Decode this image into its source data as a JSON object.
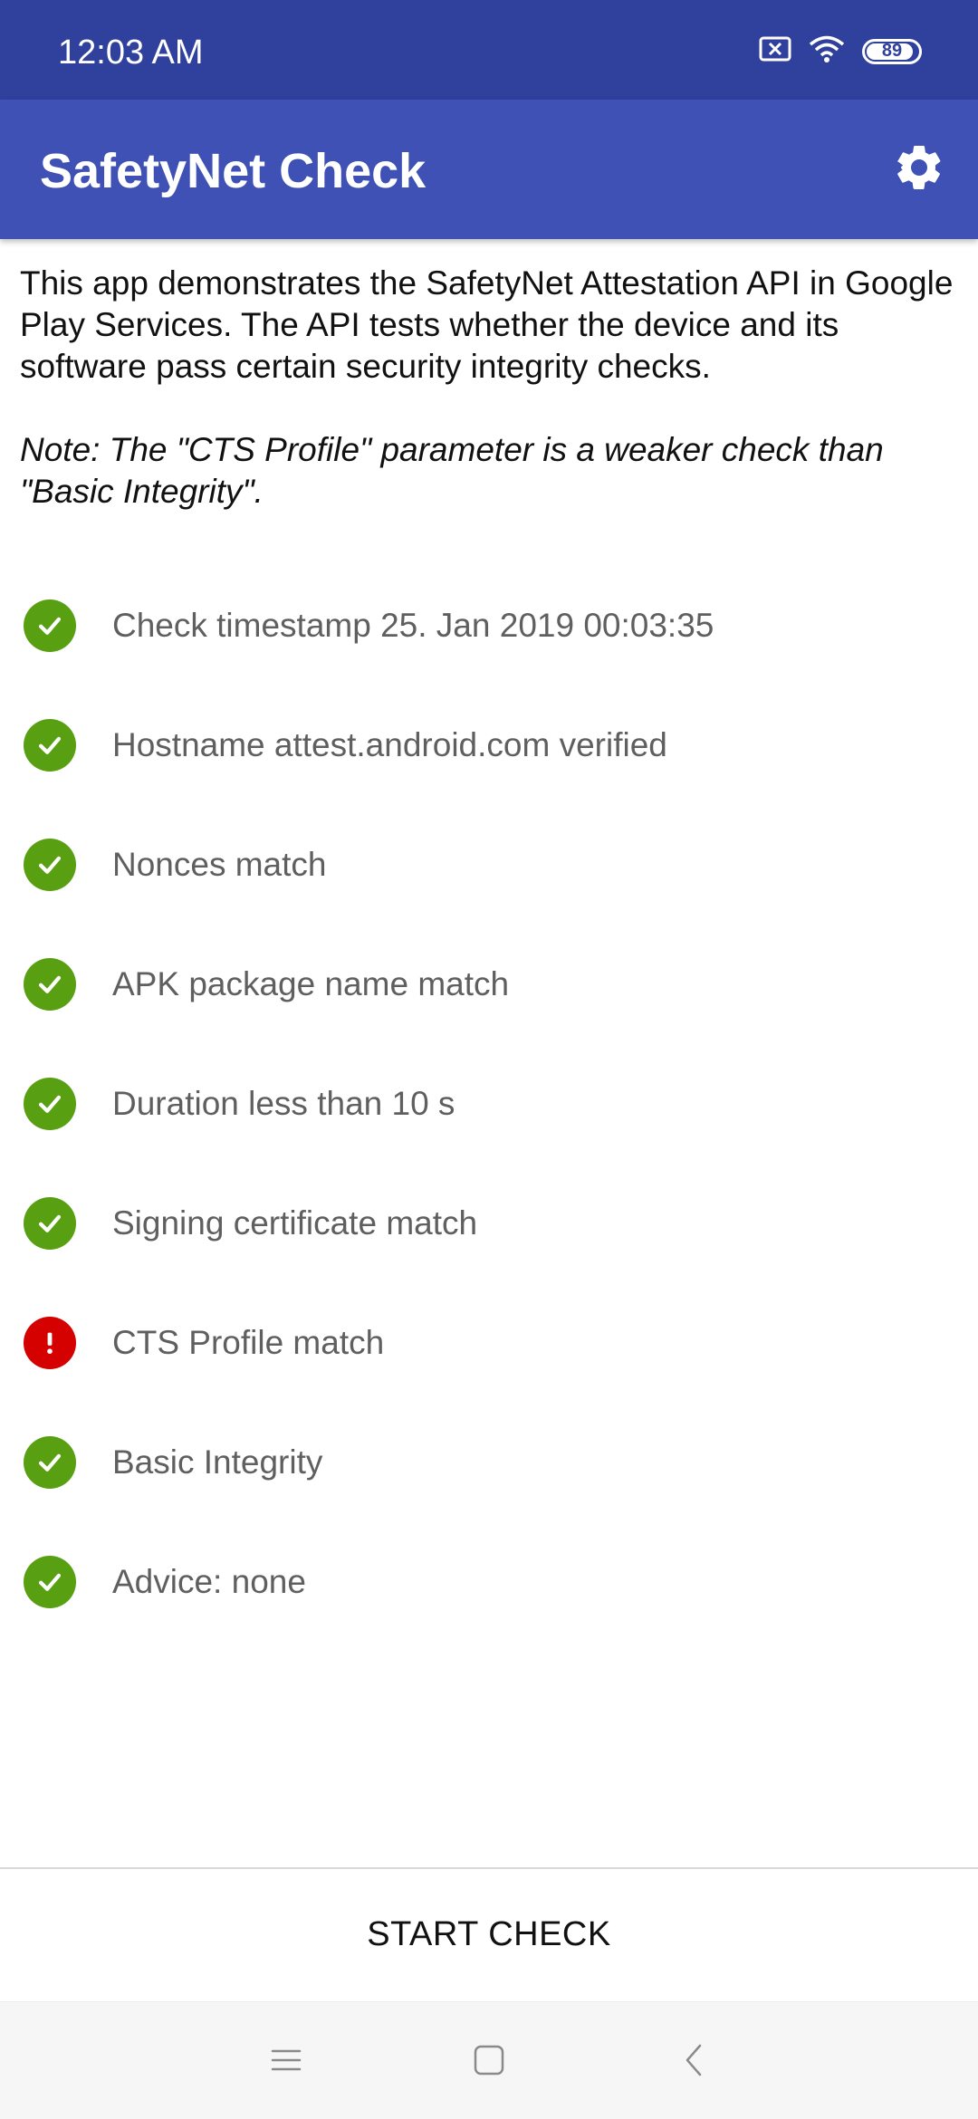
{
  "status_bar": {
    "time": "12:03  AM",
    "battery": "89",
    "icons": [
      "sim-error-icon",
      "wifi-icon",
      "battery-icon"
    ]
  },
  "app_bar": {
    "title": "SafetyNet Check",
    "settings_icon": "gear-icon"
  },
  "intro": " This app demonstrates the SafetyNet Attestation API in Google Play Services. The API tests whether the device and its software pass certain security integrity checks.",
  "note": "Note: The \"CTS Profile\" parameter is a weaker check than \"Basic Integrity\".",
  "checks": [
    {
      "label": "Check timestamp 25. Jan 2019 00:03:35",
      "status": "ok"
    },
    {
      "label": "Hostname attest.android.com verified",
      "status": "ok"
    },
    {
      "label": "Nonces match",
      "status": "ok"
    },
    {
      "label": "APK package name match",
      "status": "ok"
    },
    {
      "label": "Duration less than 10 s",
      "status": "ok"
    },
    {
      "label": "Signing certificate match",
      "status": "ok"
    },
    {
      "label": "CTS Profile match",
      "status": "error"
    },
    {
      "label": "Basic Integrity",
      "status": "ok"
    },
    {
      "label": "Advice: none",
      "status": "ok"
    }
  ],
  "start_button": "START CHECK",
  "nav": {
    "menu": "menu-icon",
    "home": "home-icon",
    "back": "back-icon"
  },
  "colors": {
    "status_bar": "#2f409d",
    "app_bar": "#3f51b5",
    "ok": "#58a012",
    "error": "#d50000"
  }
}
